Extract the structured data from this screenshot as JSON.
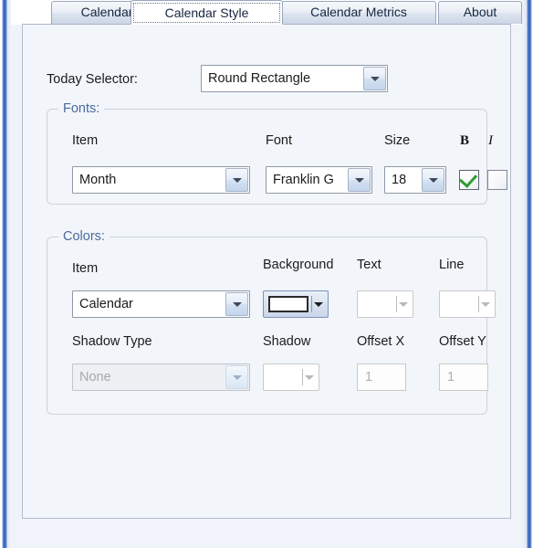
{
  "window": {
    "tabs": [
      {
        "id": "calendar",
        "label": "Calendar",
        "selected": false
      },
      {
        "id": "calendar-style",
        "label": "Calendar Style",
        "selected": true
      },
      {
        "id": "calendar-metrics",
        "label": "Calendar Metrics",
        "selected": false
      },
      {
        "id": "about",
        "label": "About",
        "selected": false
      }
    ]
  },
  "today_selector": {
    "label": "Today Selector:",
    "value": "Round Rectangle"
  },
  "fonts_group": {
    "legend": "Fonts:",
    "headers": {
      "item": "Item",
      "font": "Font",
      "size": "Size",
      "bold": "B",
      "italic": "I"
    },
    "item_value": "Month",
    "font_value": "Franklin G",
    "size_value": "18",
    "bold_checked": "true",
    "italic_checked": "false"
  },
  "colors_group": {
    "legend": "Colors:",
    "headers": {
      "item": "Item",
      "background": "Background",
      "text": "Text",
      "line": "Line",
      "shadow_type": "Shadow Type",
      "shadow": "Shadow",
      "offset_x": "Offset X",
      "offset_y": "Offset Y"
    },
    "item_value": "Calendar",
    "background_swatch": "#ffffff",
    "text_enabled": "false",
    "line_enabled": "false",
    "shadow_type_value": "None",
    "offset_x_value": "1",
    "offset_y_value": "1"
  },
  "colors": {
    "frame_blue": "#3b68c4",
    "panel_bg": "#f2f5fa",
    "legend_text": "#4a6a9d",
    "check_green": "#2f9b33"
  }
}
